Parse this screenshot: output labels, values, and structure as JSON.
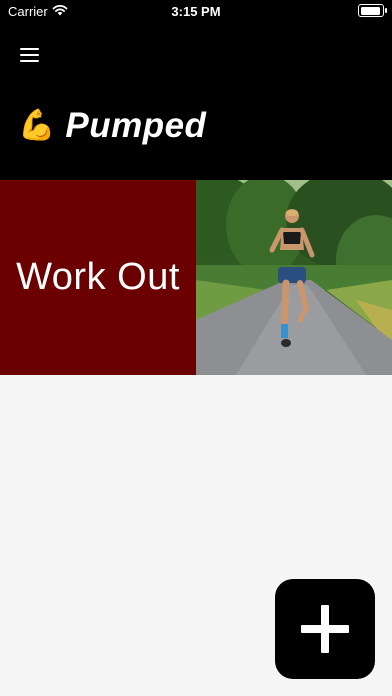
{
  "status_bar": {
    "carrier": "Carrier",
    "time": "3:15 PM",
    "wifi_icon": "wifi-icon",
    "battery_icon": "battery-icon"
  },
  "header": {
    "menu_icon": "hamburger-menu-icon",
    "app_emoji": "💪",
    "app_title": "Pumped"
  },
  "workouts": [
    {
      "label": "Work Out",
      "image": "woman-running-on-road-photo",
      "label_bg": "#6b0000"
    }
  ],
  "fab": {
    "icon": "plus-icon"
  },
  "colors": {
    "header_bg": "#000000",
    "content_bg": "#f5f5f5",
    "card_label_bg": "#6b0000",
    "fab_bg": "#000000"
  }
}
